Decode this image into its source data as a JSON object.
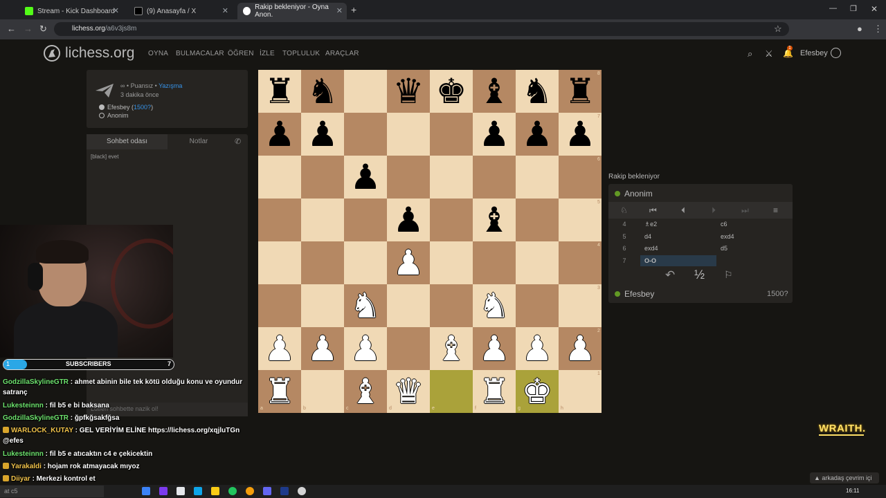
{
  "browser": {
    "tabs": [
      {
        "title": "Stream - Kick Dashboard",
        "color": "#53fc18"
      },
      {
        "title": "(9) Anasayfa / X",
        "color": "#ffffff"
      },
      {
        "title": "Rakip bekleniyor - Oyna Anon.",
        "color": "#ffffff"
      }
    ],
    "url_host": "lichess.org",
    "url_path": "/a6v3js8m"
  },
  "header": {
    "logo": "lichess.org",
    "menu": [
      "OYNA",
      "BULMACALAR",
      "ÖĞREN",
      "İZLE",
      "TOPLULUK",
      "ARAÇLAR"
    ],
    "username": "Efesbey",
    "notification_count": "1"
  },
  "game_info": {
    "mode": "∞ • Puansız • ",
    "mode_link": "Yazışma",
    "time_ago": "3 dakika önce",
    "white_player": "Efesbey",
    "white_rating": "1500?",
    "black_player": "Anonim"
  },
  "chat": {
    "tabs": [
      "Sohbet odası",
      "Notlar"
    ],
    "messages": [
      "[black] evet"
    ],
    "placeholder": "Lütfen sohbette nazik ol!"
  },
  "board": {
    "files": [
      "a",
      "b",
      "c",
      "d",
      "e",
      "f",
      "g",
      "h"
    ],
    "ranks": [
      "8",
      "7",
      "6",
      "5",
      "4",
      "3",
      "2",
      "1"
    ],
    "highlight": [
      "e1",
      "g1"
    ],
    "pieces": {
      "a8": "br",
      "b8": "bn",
      "d8": "bq",
      "e8": "bk",
      "f8": "bb",
      "g8": "bn",
      "h8": "br",
      "a7": "bp",
      "b7": "bp",
      "f7": "bp",
      "g7": "bp",
      "h7": "bp",
      "c6": "bp",
      "d5": "bp",
      "f5": "bb",
      "d4": "wp",
      "c3": "wn",
      "f3": "wn",
      "a2": "wp",
      "b2": "wp",
      "c2": "wp",
      "e2": "wb",
      "f2": "wp",
      "g2": "wp",
      "h2": "wp",
      "a1": "wr",
      "c1": "wb",
      "d1": "wq",
      "f1": "wr",
      "g1": "wk"
    }
  },
  "moves_panel": {
    "status": "Rakip bekleniyor",
    "opponent": "Anonim",
    "moves": [
      {
        "num": "4",
        "white": "♗e2",
        "black": "c6"
      },
      {
        "num": "5",
        "white": "d4",
        "black": "exd4"
      },
      {
        "num": "6",
        "white": "exd4",
        "black": "d5"
      },
      {
        "num": "7",
        "white": "O-O",
        "black": ""
      }
    ],
    "draw_offer": "½",
    "self": "Efesbey",
    "self_rating": "1500?"
  },
  "stream_overlay": {
    "subscribers_label": "SUBSCRIBERS",
    "subscribers_current": "1",
    "subscribers_goal": "7",
    "subscribers_progress": 0.14,
    "chat": [
      {
        "user": "GodzillaSkylineGTR",
        "text": " : ahmet abinin bile tek kötü olduğu konu ve oyundur satranç",
        "badge": false
      },
      {
        "user": "Lukesteinnn",
        "text": " : fil b5 e bi baksana",
        "badge": false
      },
      {
        "user": "GodzillaSkylineGTR",
        "text": " : ğpfkğsakfğsa",
        "badge": false
      },
      {
        "user": "WARLOCK_KUTAY",
        "text": " : GEL VERİYİM ELİNE https://lichess.org/xqjluTGn @efes",
        "badge": true
      },
      {
        "user": "Lukesteinnn",
        "text": " : fil b5 e atıcaktın c4 e çekicektin",
        "badge": false
      },
      {
        "user": "Yarakaldi",
        "text": " : hojam rok atmayacak mıyoz",
        "badge": true
      },
      {
        "user": "Diiyar",
        "text": " : Merkezi kontrol et",
        "badge": true
      }
    ],
    "brand": "WRAITH."
  },
  "footer": {
    "online_friends": "arkadaş çevrim içi",
    "taskbar_search": "at c5",
    "clock": "16:11"
  }
}
